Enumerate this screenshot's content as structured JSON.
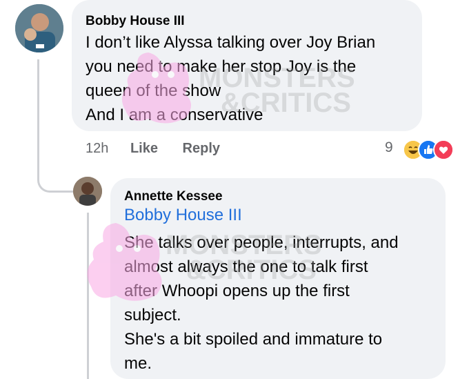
{
  "comments": [
    {
      "author": "Bobby House III",
      "lines": [
        "I don’t like Alyssa talking over Joy Brian",
        "you need to make her stop Joy is the",
        "queen of the show",
        "And I am a conservative"
      ],
      "time": "12h",
      "like_label": "Like",
      "reply_label": "Reply",
      "reaction_count": "9",
      "reactions": [
        "haha-icon",
        "like-icon",
        "love-icon"
      ]
    },
    {
      "author": "Annette Kessee",
      "mention": "Bobby House III",
      "lines": [
        "She talks over people, interrupts, and",
        "almost always the one to talk first",
        "after Whoopi opens up the first",
        "subject.",
        "She's a bit spoiled and immature to",
        "me."
      ]
    }
  ],
  "watermark": {
    "line1": "MONSTERS",
    "line2": "&CRITICS"
  },
  "colors": {
    "bubble": "#f0f2f5",
    "mention": "#216fdb",
    "meta": "#65676b",
    "watermark_pink": "#f9a8e4"
  }
}
